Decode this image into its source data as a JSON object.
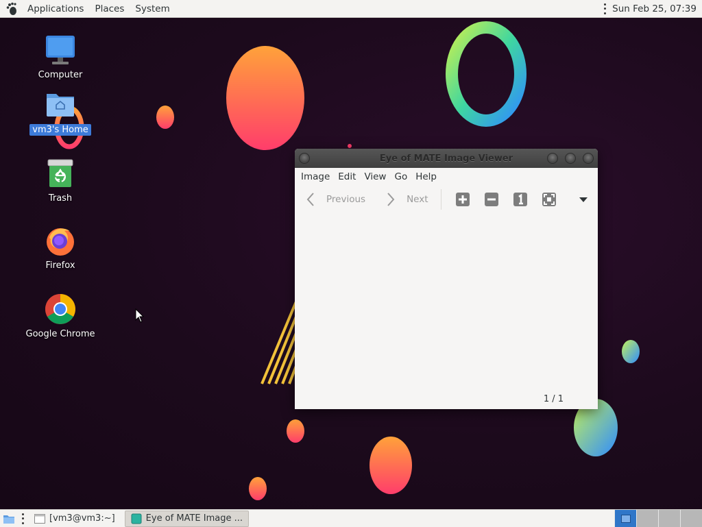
{
  "top_panel": {
    "menus": [
      "Applications",
      "Places",
      "System"
    ],
    "clock": "Sun Feb 25, 07:39",
    "logo_icon": "gnome-foot-icon"
  },
  "desktop": {
    "icons": [
      {
        "label": "Computer",
        "icon": "computer-icon",
        "selected": false
      },
      {
        "label": "vm3's Home",
        "icon": "home-folder-icon",
        "selected": true
      },
      {
        "label": "Trash",
        "icon": "trash-icon",
        "selected": false
      },
      {
        "label": "Firefox",
        "icon": "firefox-icon",
        "selected": false
      },
      {
        "label": "Google Chrome",
        "icon": "chrome-icon",
        "selected": false
      }
    ]
  },
  "window": {
    "title": "Eye of MATE Image Viewer",
    "menu": [
      "Image",
      "Edit",
      "View",
      "Go",
      "Help"
    ],
    "toolbar": {
      "previous_label": "Previous",
      "next_label": "Next",
      "tools": [
        "zoom-in-icon",
        "zoom-out-icon",
        "normal-size-icon",
        "best-fit-icon",
        "dropdown-arrow-icon"
      ]
    },
    "status": "1 / 1"
  },
  "taskbar": {
    "items": [
      {
        "label": "[vm3@vm3:~]",
        "icon": "terminal-window-icon",
        "active": false
      },
      {
        "label": "Eye of MATE Image ...",
        "icon": "image-viewer-icon",
        "active": true
      }
    ],
    "workspace_count": 4,
    "active_workspace": 1
  },
  "colors": {
    "panel": "#f4f3f1",
    "desktop_bg": "#1c0a1c",
    "accent": "#3d7bd9",
    "titlebar": "#4a4a4a"
  }
}
